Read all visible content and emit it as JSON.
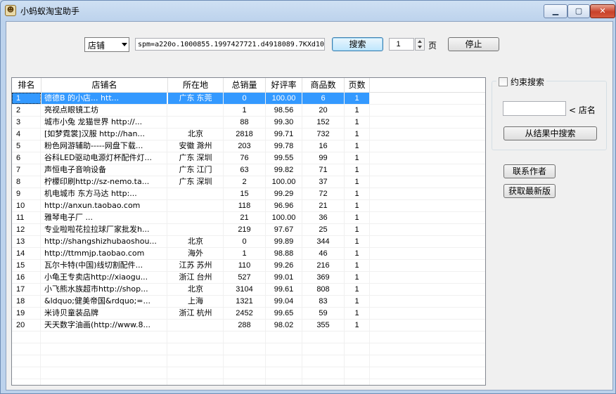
{
  "window": {
    "title": "小蚂蚁淘宝助手"
  },
  "toolbar": {
    "mode": "店铺",
    "url": "spm=a220o.1000855.1997427721.d4918089.7KXd10",
    "search_label": "搜索",
    "page_value": "1",
    "page_unit": "页",
    "stop_label": "停止"
  },
  "table": {
    "headers": [
      "排名",
      "店铺名",
      "所在地",
      "总销量",
      "好评率",
      "商品数",
      "页数"
    ],
    "rows": [
      [
        "1",
        "德德B 的小店...          htt...",
        "广东 东莞",
        "0",
        "100.00",
        "6",
        "1"
      ],
      [
        "2",
        "         亮视点眼镜工坊",
        "",
        "1",
        "98.56",
        "20",
        "1"
      ],
      [
        "3",
        "城市小兔 龙猫世界 http://...",
        "",
        "88",
        "99.30",
        "152",
        "1"
      ],
      [
        "4",
        "[如梦霓裳]汉服 http://han...",
        "北京",
        "2818",
        "99.71",
        "732",
        "1"
      ],
      [
        "5",
        "粉色网游辅助-----网盘下载...",
        "安徽 滁州",
        "203",
        "99.78",
        "16",
        "1"
      ],
      [
        "6",
        "谷科LED驱动电源灯杯配件灯...",
        "广东 深圳",
        "76",
        "99.55",
        "99",
        "1"
      ],
      [
        "7",
        "      声恒电子音响设备",
        "广东 江门",
        "63",
        "99.82",
        "71",
        "1"
      ],
      [
        "8",
        "柠檬印刷http://sz-nemo.ta...",
        "广东 深圳",
        "2",
        "100.00",
        "37",
        "1"
      ],
      [
        "9",
        "机电城市 东方马达    http:...",
        "",
        "15",
        "99.29",
        "72",
        "1"
      ],
      [
        "10",
        "    http://anxun.taobao.com",
        "",
        "118",
        "96.96",
        "21",
        "1"
      ],
      [
        "11",
        "雅琴电子厂                 ...",
        "",
        "21",
        "100.00",
        "36",
        "1"
      ],
      [
        "12",
        "专业啦啦花拉拉球厂家批发h...",
        "",
        "219",
        "97.67",
        "25",
        "1"
      ],
      [
        "13",
        "http://shangshizhubaoshou...",
        "北京",
        "0",
        "99.89",
        "344",
        "1"
      ],
      [
        "14",
        "    http://ttmmjp.taobao.com",
        "海外",
        "1",
        "98.88",
        "46",
        "1"
      ],
      [
        "15",
        " 瓦尔卡特(中国)线切割配件...",
        "江苏 苏州",
        "110",
        "99.26",
        "216",
        "1"
      ],
      [
        "16",
        "小龟王专卖店http://xiaogu...",
        "浙江 台州",
        "527",
        "99.01",
        "369",
        "1"
      ],
      [
        "17",
        "小飞熊水族超市http://shop...",
        "北京",
        "3104",
        "99.61",
        "808",
        "1"
      ],
      [
        "18",
        "&ldquo;健美帝国&rdquo;=...",
        "上海",
        "1321",
        "99.04",
        "83",
        "1"
      ],
      [
        "19",
        "      米诗贝童装品牌",
        "浙江 杭州",
        "2452",
        "99.65",
        "59",
        "1"
      ],
      [
        "20",
        "天天数字油画(http://www.8...",
        "",
        "288",
        "98.02",
        "355",
        "1"
      ]
    ]
  },
  "panel": {
    "constrain_label": "约束搜索",
    "constrain_checked": false,
    "name_value": "",
    "name_label": "< 店名",
    "from_results_label": "从结果中搜索",
    "contact_label": "联系作者",
    "latest_label": "获取最新版"
  },
  "colors": {
    "selection": "#3399ff",
    "close_button": "#c8412a"
  }
}
